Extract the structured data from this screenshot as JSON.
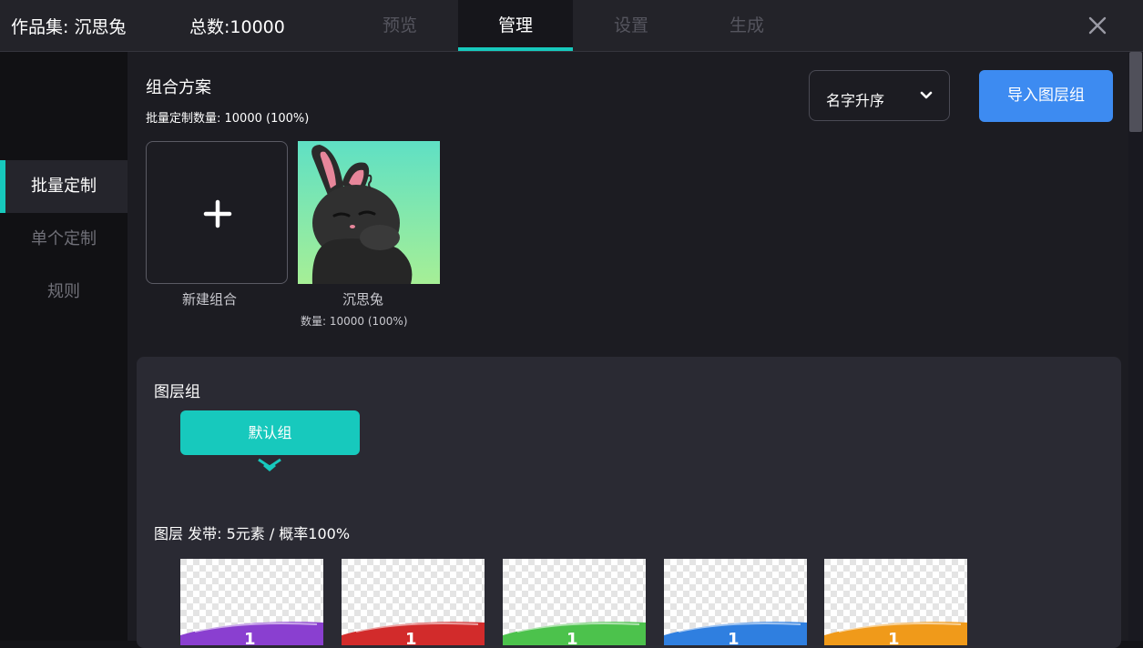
{
  "header": {
    "collection": "作品集: 沉思兔",
    "total": "总数:10000",
    "tabs": [
      {
        "label": "预览",
        "active": false
      },
      {
        "label": "管理",
        "active": true
      },
      {
        "label": "设置",
        "active": false
      },
      {
        "label": "生成",
        "active": false
      }
    ],
    "close_icon": "close-icon"
  },
  "sidebar": {
    "items": [
      {
        "label": "批量定制",
        "active": true
      },
      {
        "label": "单个定制",
        "active": false
      },
      {
        "label": "规则",
        "active": false
      }
    ]
  },
  "scheme": {
    "title": "组合方案",
    "count_line": "批量定制数量: 10000 (100%)",
    "sort_label": "名字升序",
    "import_label": "导入图层组",
    "new_label": "新建组合",
    "new_icon": "plus-icon",
    "item": {
      "name": "沉思兔",
      "count": "数量: 10000 (100%)"
    }
  },
  "layer_group": {
    "title": "图层组",
    "default_group": "默认组",
    "layer_line": "图层 发带: 5元素 / 概率100%",
    "ribbon_label": "1",
    "ribbons": [
      {
        "color": "#8a3fd0"
      },
      {
        "color": "#d22b2b"
      },
      {
        "color": "#4cc24c"
      },
      {
        "color": "#2f7fe0"
      },
      {
        "color": "#f09a1a"
      }
    ]
  },
  "colors": {
    "accent": "#17c9bd",
    "primary_button": "#3d8bf1"
  }
}
